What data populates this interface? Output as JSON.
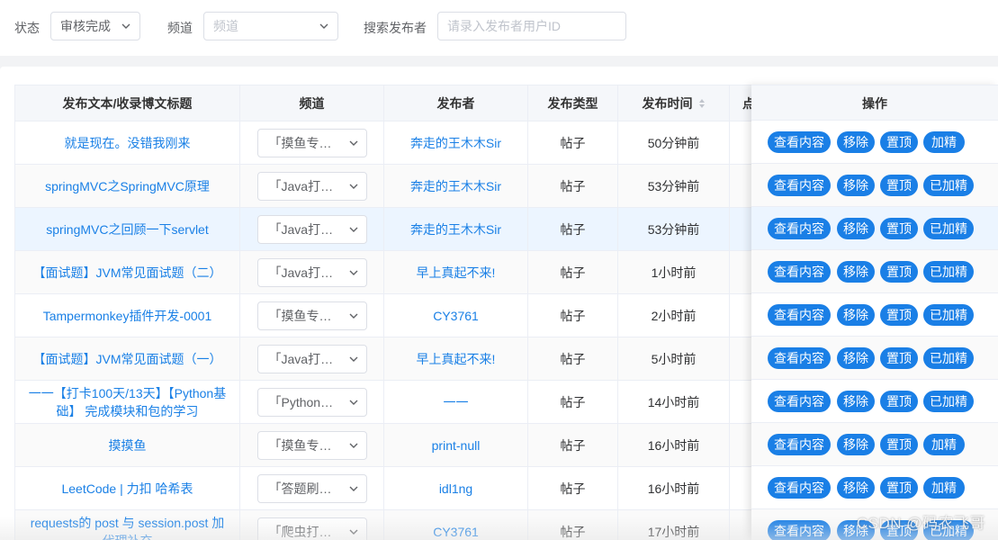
{
  "filters": {
    "status_label": "状态",
    "status_value": "审核完成",
    "channel_label": "频道",
    "channel_placeholder": "频道",
    "publisher_label": "搜索发布者",
    "publisher_placeholder": "请录入发布者用户ID"
  },
  "table": {
    "headers": {
      "title": "发布文本/收录博文标题",
      "channel": "频道",
      "publisher": "发布者",
      "type": "发布类型",
      "time": "发布时间",
      "partial": "点",
      "actions": "操作"
    },
    "rows": [
      {
        "title": "就是现在。没错我刚来",
        "channel": "「摸鱼专区」",
        "publisher": "奔走的王木木Sir",
        "type": "帖子",
        "time": "50分钟前",
        "actions": [
          "查看内容",
          "移除",
          "置顶",
          "加精"
        ]
      },
      {
        "title": "springMVC之SpringMVC原理",
        "channel": "「Java打卡」",
        "publisher": "奔走的王木木Sir",
        "type": "帖子",
        "time": "53分钟前",
        "actions": [
          "查看内容",
          "移除",
          "置顶",
          "已加精"
        ]
      },
      {
        "title": "springMVC之回顾一下servlet",
        "channel": "「Java打卡」",
        "publisher": "奔走的王木木Sir",
        "type": "帖子",
        "time": "53分钟前",
        "actions": [
          "查看内容",
          "移除",
          "置顶",
          "已加精"
        ]
      },
      {
        "title": "【面试题】JVM常见面试题（二）",
        "channel": "「Java打卡」",
        "publisher": "早上真起不来!",
        "type": "帖子",
        "time": "1小时前",
        "actions": [
          "查看内容",
          "移除",
          "置顶",
          "已加精"
        ]
      },
      {
        "title": "Tampermonkey插件开发-0001",
        "channel": "「摸鱼专区」",
        "publisher": "CY3761",
        "type": "帖子",
        "time": "2小时前",
        "actions": [
          "查看内容",
          "移除",
          "置顶",
          "已加精"
        ]
      },
      {
        "title": "【面试题】JVM常见面试题（一）",
        "channel": "「Java打卡」",
        "publisher": "早上真起不来!",
        "type": "帖子",
        "time": "5小时前",
        "actions": [
          "查看内容",
          "移除",
          "置顶",
          "已加精"
        ]
      },
      {
        "title": "一一【打卡100天/13天】【Python基础】 完成模块和包的学习",
        "channel": "「Python打卡」",
        "publisher": "一一",
        "type": "帖子",
        "time": "14小时前",
        "actions": [
          "查看内容",
          "移除",
          "置顶",
          "已加精"
        ]
      },
      {
        "title": "摸摸鱼",
        "channel": "「摸鱼专区」",
        "publisher": "print-null",
        "type": "帖子",
        "time": "16小时前",
        "actions": [
          "查看内容",
          "移除",
          "置顶",
          "加精"
        ]
      },
      {
        "title": "LeetCode | 力扣 哈希表",
        "channel": "「答题刷题」",
        "publisher": "idl1ng",
        "type": "帖子",
        "time": "16小时前",
        "actions": [
          "查看内容",
          "移除",
          "置顶",
          "加精"
        ]
      },
      {
        "title": "requests的 post 与 session.post 加 代理补充",
        "channel": "「爬虫打卡」",
        "publisher": "CY3761",
        "type": "帖子",
        "time": "17小时前",
        "actions": [
          "查看内容",
          "移除",
          "置顶",
          "已加精"
        ]
      }
    ]
  },
  "watermark": "CSDN @码农飞哥",
  "colors": {
    "link": "#1a80e6",
    "button": "#1a7fe6",
    "hover_row": "#ecf5ff"
  }
}
